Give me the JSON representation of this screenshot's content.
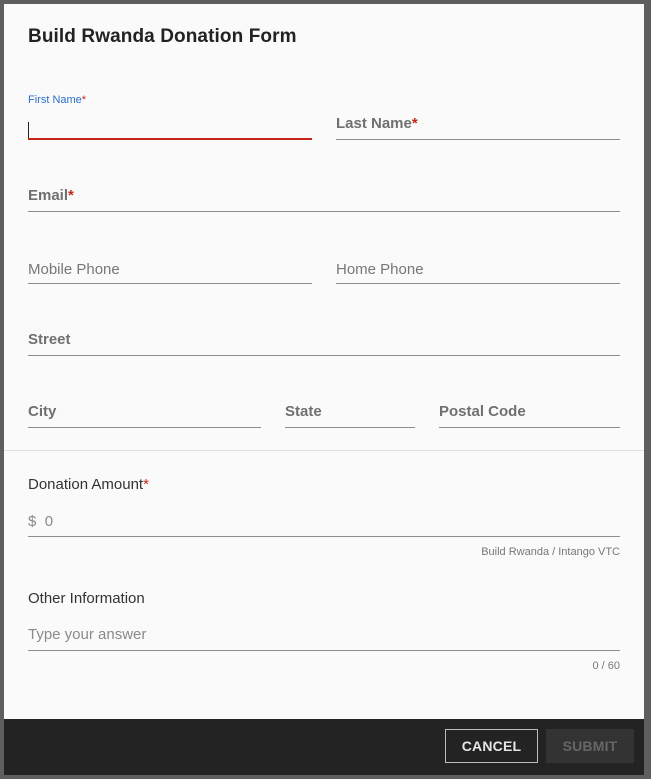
{
  "dialog": {
    "title": "Build Rwanda Donation Form"
  },
  "fields": {
    "first_name": {
      "label": "First Name",
      "required_mark": "*",
      "value": ""
    },
    "last_name": {
      "label": "Last Name",
      "required_mark": "*"
    },
    "email": {
      "label": "Email",
      "required_mark": "*"
    },
    "mobile_phone": {
      "placeholder": "Mobile Phone"
    },
    "home_phone": {
      "placeholder": "Home Phone"
    },
    "street": {
      "label": "Street"
    },
    "city": {
      "label": "City"
    },
    "state": {
      "label": "State"
    },
    "postal_code": {
      "label": "Postal Code"
    }
  },
  "donation": {
    "label": "Donation Amount",
    "required_mark": "*",
    "currency_symbol": "$",
    "value": "0",
    "hint": "Build Rwanda / Intango VTC"
  },
  "other": {
    "label": "Other Information",
    "placeholder": "Type your answer",
    "counter": "0 / 60"
  },
  "footer": {
    "cancel_label": "CANCEL",
    "submit_label": "SUBMIT"
  },
  "colors": {
    "accent_error": "#c4261a",
    "focus_label": "#2a6fc9",
    "footer_bg": "#232323"
  }
}
